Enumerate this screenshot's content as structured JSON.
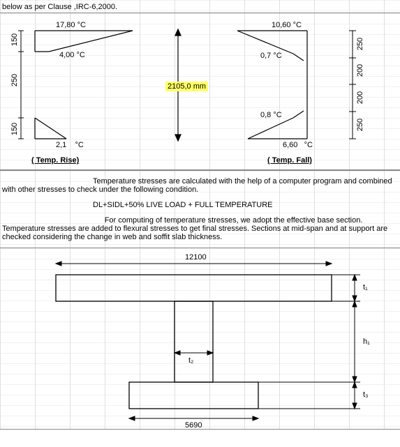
{
  "intro": {
    "text": "below as per Clause   ,IRC-6,2000."
  },
  "tempDiagram": {
    "rise": {
      "t1": "17,80",
      "t2": "4,00",
      "t3": "2,1",
      "unit": "°C",
      "caption": "( Temp. Rise)"
    },
    "fall": {
      "t1": "10,60",
      "t2": "0,7",
      "t3": "0,8",
      "t4": "6,60",
      "unit": "°C",
      "caption": "( Temp. Fall)"
    },
    "depth": "2105,0 mm",
    "dims": {
      "d1": "250",
      "d2": "200",
      "d3": "200",
      "d4": "250"
    },
    "leftDims": {
      "top": "150",
      "mid": "250",
      "bot": "150"
    }
  },
  "body": {
    "p1": "Temperature stresses are calculated with the help of a computer program and combined with other stresses to check under the following condition.",
    "formula": "DL+SIDL+50% LIVE LOAD + FULL TEMPERATURE",
    "p2": "For computing of temperature stresses, we adopt the effective base section. Temperature stresses are added to flexural stresses to get final stresses. Sections at mid-span and at support are checked considering the change in web and soffit slab thickness."
  },
  "section": {
    "topWidth": "12100",
    "botWidth": "5690",
    "t1": "t₁",
    "t2": "t₂",
    "t3": "t₃",
    "h1": "h₁"
  }
}
